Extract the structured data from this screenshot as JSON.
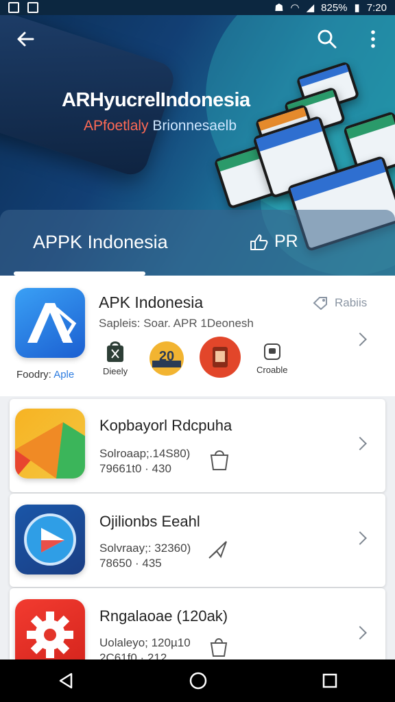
{
  "status": {
    "battery": "825%",
    "time": "7:20"
  },
  "hero": {
    "title": "ARHyucrelIndonesia",
    "subtitle_red": "APfoetlaly",
    "subtitle_blue": "Brionnesaelb"
  },
  "tabs": [
    {
      "label": "APPK Indonesia"
    },
    {
      "label": "PR"
    }
  ],
  "featured": {
    "title": "APK Indonesia",
    "subtitle": "Sapleis: Soar. APR 1Deonesh",
    "rating": "Rabiis",
    "caption_prefix": "Foodry:",
    "caption_link": "Aple",
    "mini_apps": [
      {
        "label": "Dieely",
        "icon": "shopping-bag-icon"
      },
      {
        "label": "",
        "icon": "badge-20-icon"
      },
      {
        "label": "",
        "icon": "red-circle-app-icon"
      },
      {
        "label": "Croable",
        "icon": "box-icon"
      }
    ]
  },
  "apps": [
    {
      "title": "Kopbayorl Rdcpuha",
      "line1": "Solroaap;.14S80)",
      "line2": "79661t0 · 430",
      "icon": "paper-plane-color-icon"
    },
    {
      "title": "Ojilionbs Eeahl",
      "line1": "Solvraay;: 32360)",
      "line2": "78650 · 435",
      "icon": "play-circle-icon"
    },
    {
      "title": "Rngalaoae (120ak)",
      "line1": "Uolaleyo; 120µ10",
      "line2": "2C61f0 · 212",
      "icon": "gear-icon"
    }
  ]
}
